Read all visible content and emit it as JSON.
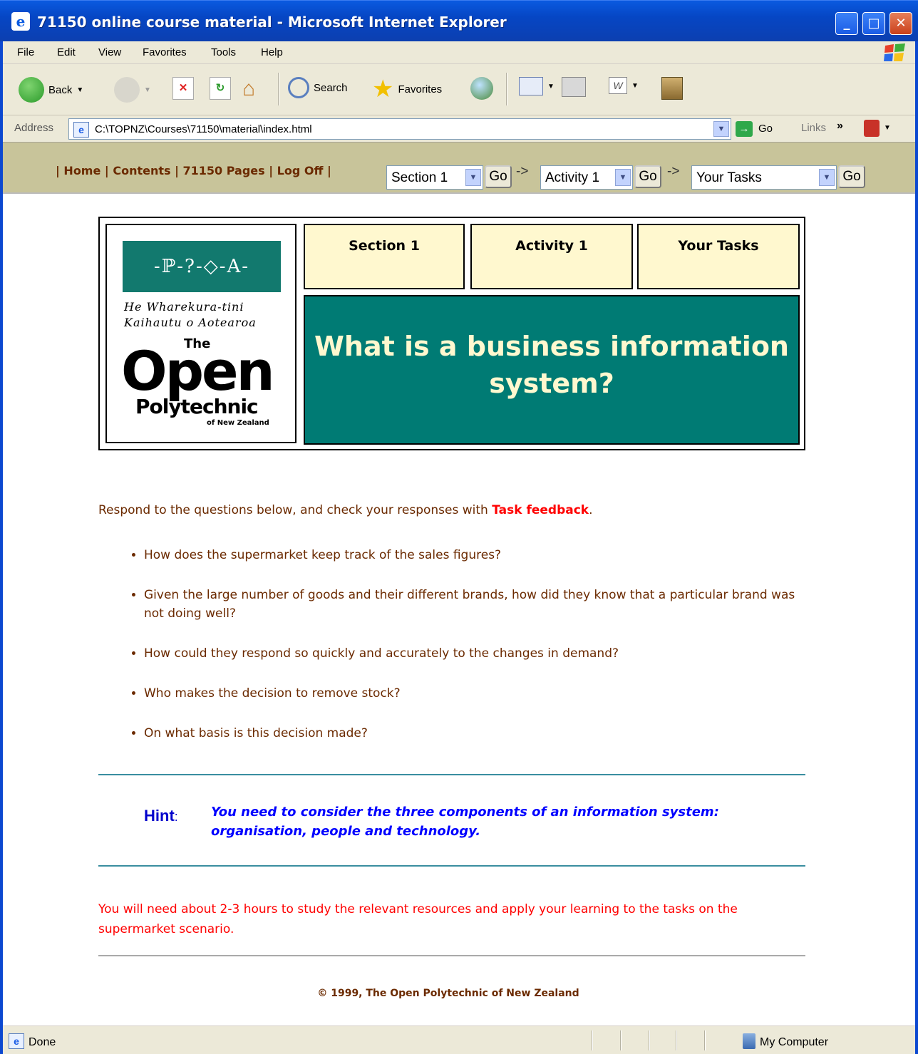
{
  "window": {
    "title": "71150 online course material - Microsoft Internet Explorer"
  },
  "menu": {
    "items": [
      "File",
      "Edit",
      "View",
      "Favorites",
      "Tools",
      "Help"
    ]
  },
  "toolbar": {
    "back": "Back",
    "search": "Search",
    "favorites": "Favorites"
  },
  "address": {
    "label": "Address",
    "url": "C:\\TOPNZ\\Courses\\71150\\material\\index.html",
    "go": "Go",
    "links": "Links"
  },
  "nav": {
    "links": [
      "Home",
      "Contents",
      "71150 Pages",
      "Log Off"
    ],
    "section_select": "Section 1",
    "activity_select": "Activity 1",
    "tasks_select": "Your Tasks",
    "go_label": "Go",
    "arrow": "->"
  },
  "logo": {
    "banner": "-ℙ-?-◇-A-",
    "maori_line1": "He Wharekura-tini",
    "maori_line2": "Kaihautu o Aotearoa",
    "the": "The",
    "open": "Open",
    "polytechnic": "Polytechnic",
    "nz": "of New Zealand"
  },
  "header": {
    "tab1": "Section 1",
    "tab2": "Activity 1",
    "tab3": "Your Tasks",
    "title": "What is a business information system?"
  },
  "main": {
    "intro_text": "Respond to the questions below, and check your responses with ",
    "intro_link": "Task feedback",
    "intro_end": ".",
    "questions": [
      "How does the supermarket keep track of the sales figures?",
      "Given the large number of goods and their different brands, how did they know that a particular brand was not doing well?",
      "How could they respond so quickly and accurately to the changes in demand?",
      "Who makes the decision to remove stock?",
      "On what basis is this decision made?"
    ],
    "hint_label": "Hint",
    "hint_colon": ":",
    "hint_text": "You need to consider the three components of an information system: organisation, people and technology.",
    "time_note": "You will need about 2-3 hours to study the relevant resources and apply your learning to the tasks on the supermarket scenario.",
    "copyright": "© 1999, The Open Polytechnic of New Zealand"
  },
  "status": {
    "left": "Done",
    "zone": "My Computer"
  },
  "colors": {
    "nav_bg": "#c8c49a",
    "title_bg": "#007b74",
    "tab_bg": "#fff8cf",
    "link_red": "#ff0000",
    "text_brown": "#6b2a00",
    "hint_blue": "#0000ff"
  }
}
